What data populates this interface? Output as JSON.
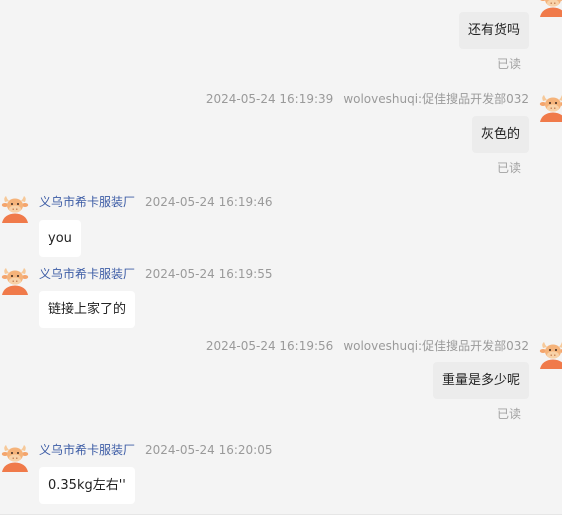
{
  "messages": [
    {
      "side": "right",
      "text": "还有货吗",
      "read": "已读"
    },
    {
      "side": "right",
      "time": "2024-05-24 16:19:39",
      "sender": "woloveshuqi:促佳搜品开发部032",
      "text": "灰色的",
      "read": "已读"
    },
    {
      "side": "left",
      "sender": "义乌市希卡服装厂",
      "time": "2024-05-24 16:19:46",
      "text": "you"
    },
    {
      "side": "left",
      "sender": "义乌市希卡服装厂",
      "time": "2024-05-24 16:19:55",
      "text": "链接上家了的"
    },
    {
      "side": "right",
      "time": "2024-05-24 16:19:56",
      "sender": "woloveshuqi:促佳搜品开发部032",
      "text": "重量是多少呢",
      "read": "已读"
    },
    {
      "side": "left",
      "sender": "义乌市希卡服装厂",
      "time": "2024-05-24 16:20:05",
      "text": "0.35kg左右''"
    }
  ],
  "colors": {
    "background": "#f4f4f4",
    "outgoing_bubble": "#ececec",
    "incoming_bubble": "#ffffff",
    "sender_name_left": "#3b5ba5",
    "meta_gray": "#9a9a9a",
    "avatar_orange": "#f07a4a"
  },
  "icons": {
    "avatar": "cartoon-bull-avatar-icon"
  }
}
